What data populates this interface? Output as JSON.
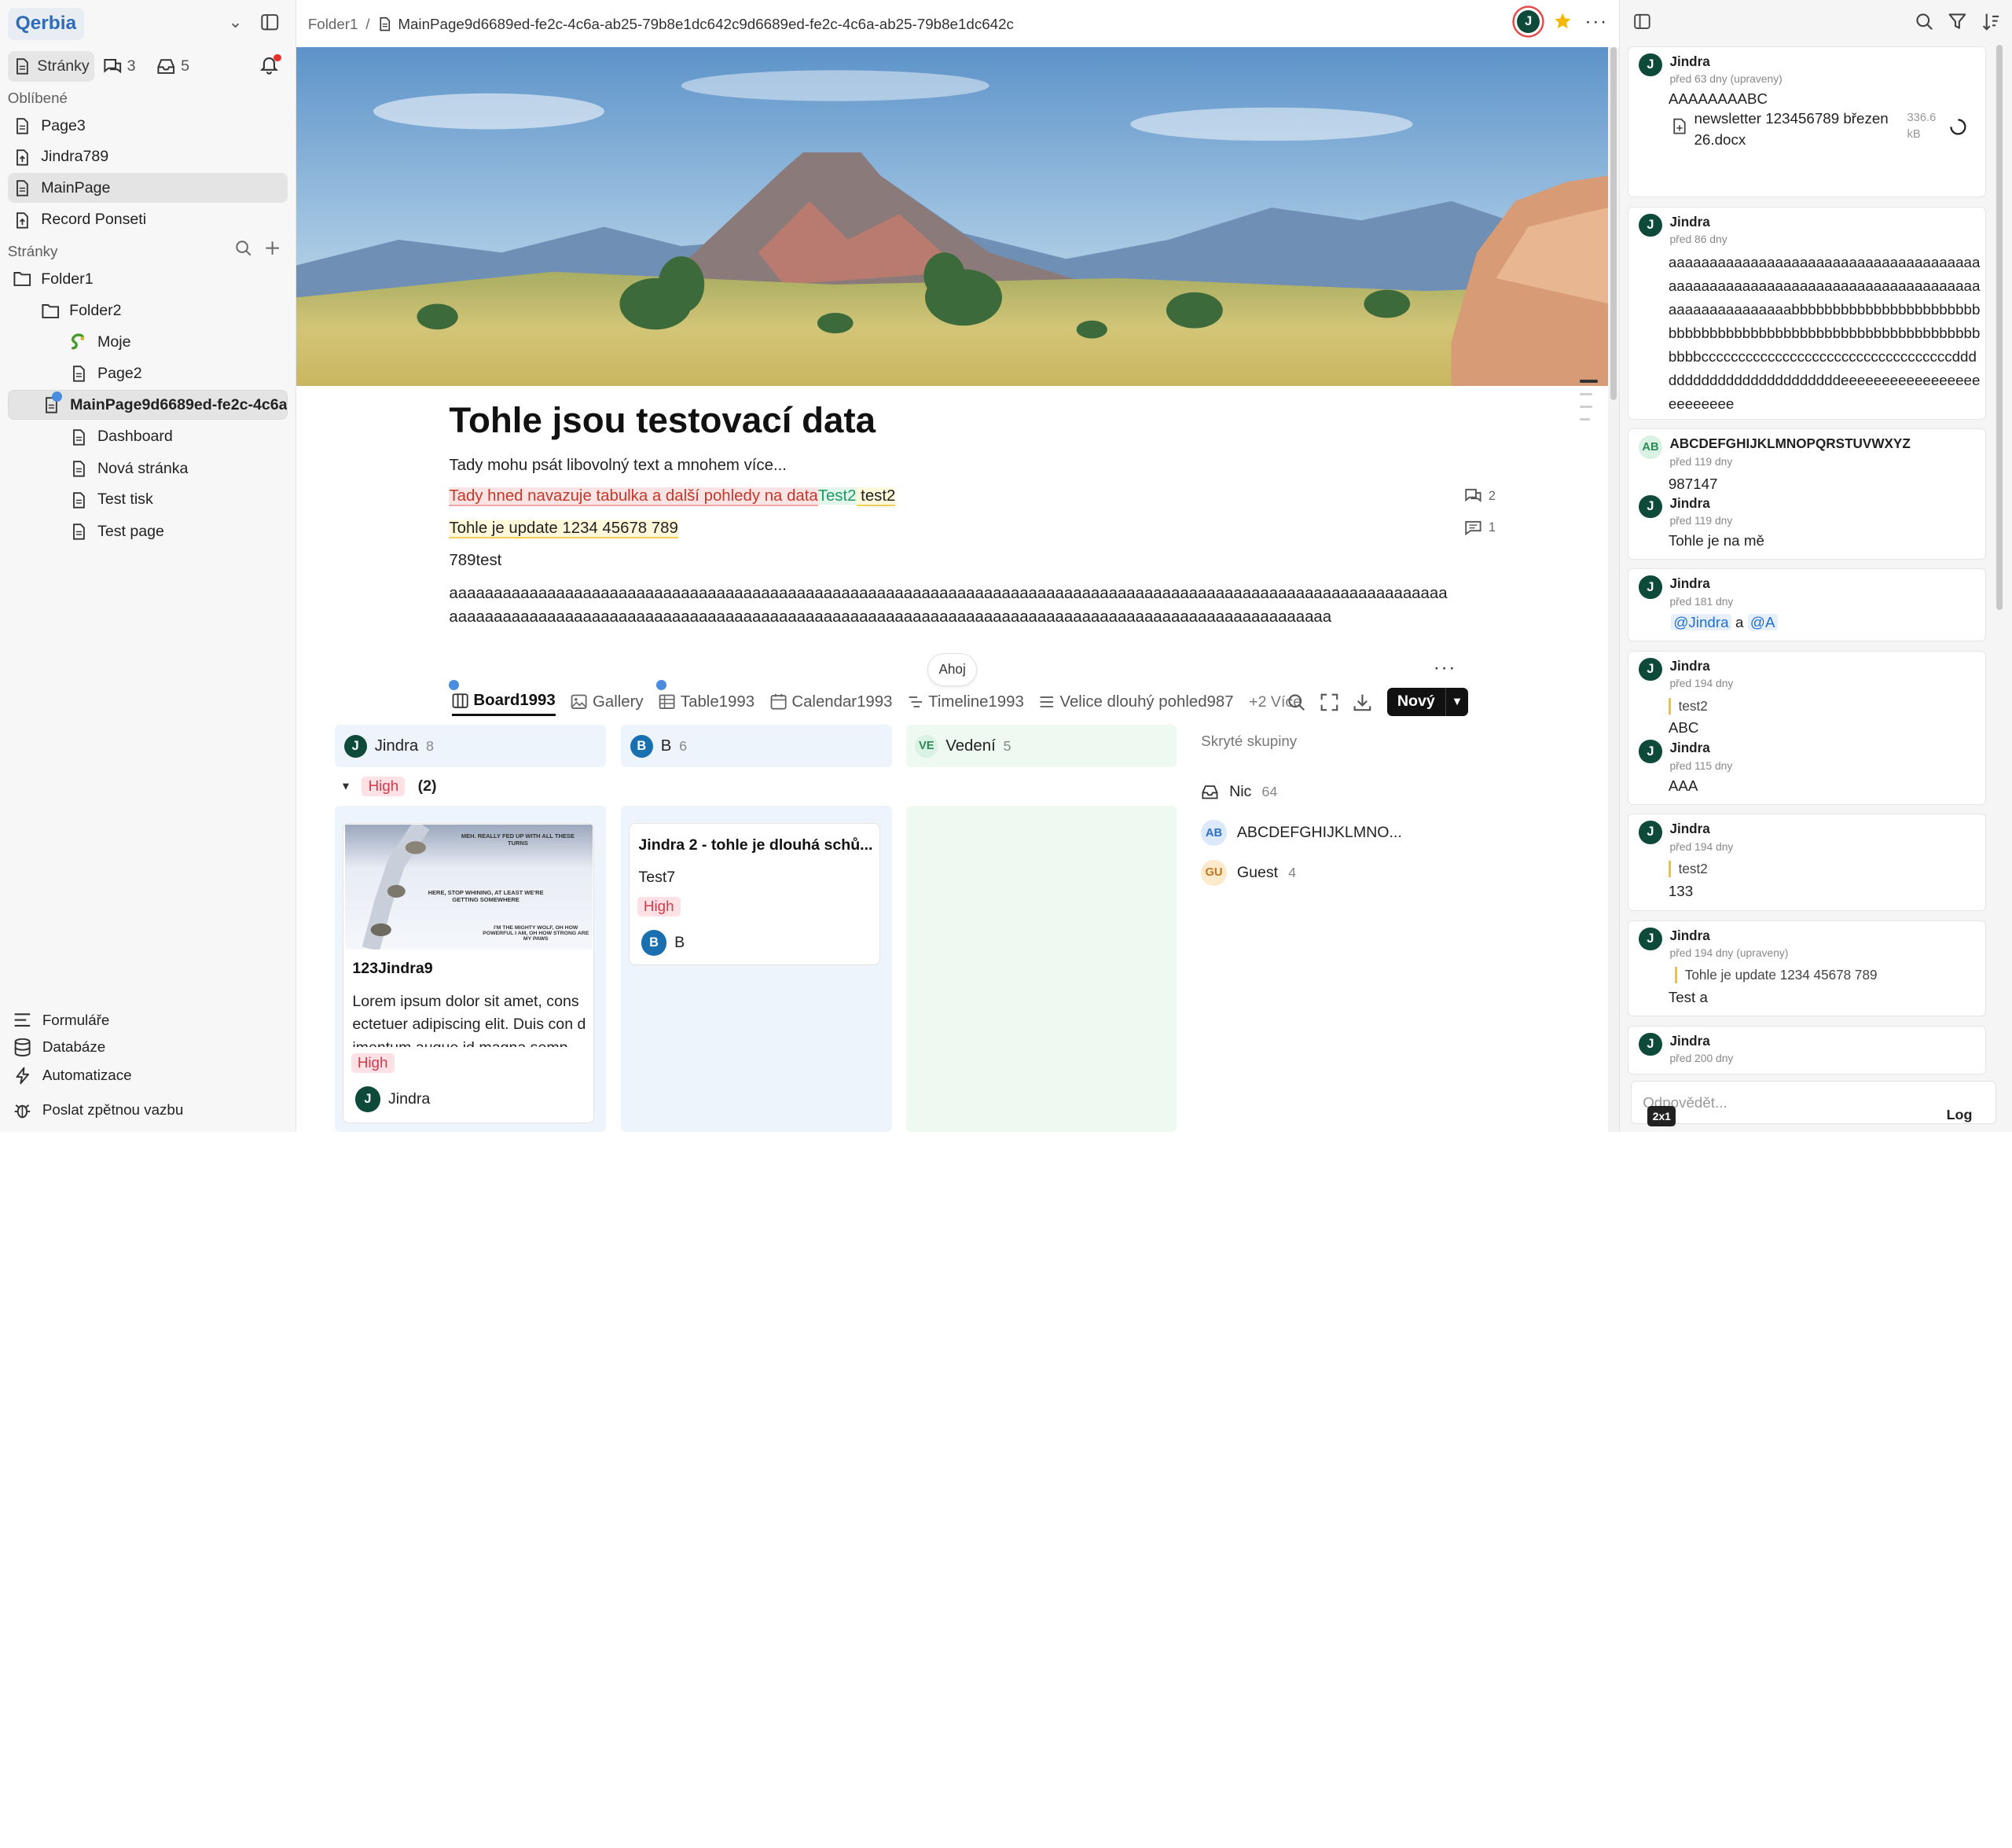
{
  "sidebar": {
    "logo": "Qerbia",
    "tabs": [
      {
        "label": "Stránky",
        "icon": "page-icon"
      },
      {
        "count": "3",
        "icon": "chat-icon"
      },
      {
        "count": "5",
        "icon": "inbox-icon"
      }
    ],
    "favorites_label": "Oblíbené",
    "favorites": [
      {
        "label": "Page3",
        "icon": "page-icon"
      },
      {
        "label": "Jindra789",
        "icon": "record-icon"
      },
      {
        "label": "MainPage",
        "icon": "page-icon",
        "active": true
      },
      {
        "label": "Record Ponseti",
        "icon": "record-icon"
      }
    ],
    "pages_label": "Stránky",
    "tree": [
      {
        "label": "Folder1",
        "icon": "folder-icon",
        "level": 0
      },
      {
        "label": "Folder2",
        "icon": "folder-icon",
        "level": 1
      },
      {
        "label": "Moje",
        "icon": "snake-icon",
        "level": 2
      },
      {
        "label": "Page2",
        "icon": "page-icon",
        "level": 2
      },
      {
        "label": "MainPage9d6689ed-fe2c-4c6a-a...",
        "icon": "page-icon",
        "level": 1,
        "selected": true
      },
      {
        "label": "Dashboard",
        "icon": "page-icon",
        "level": 2
      },
      {
        "label": "Nová stránka",
        "icon": "page-icon",
        "level": 2
      },
      {
        "label": "Test tisk",
        "icon": "page-icon",
        "level": 2
      },
      {
        "label": "Test page",
        "icon": "page-icon",
        "level": 2
      }
    ],
    "bottom": [
      {
        "label": "Formuláře",
        "icon": "form-icon"
      },
      {
        "label": "Databáze",
        "icon": "database-icon"
      },
      {
        "label": "Automatizace",
        "icon": "lightning-icon"
      },
      {
        "label": "Poslat zpětnou vazbu",
        "icon": "bug-icon"
      }
    ]
  },
  "topbar": {
    "breadcrumb_folder": "Folder1",
    "breadcrumb_sep": "/",
    "breadcrumb_page": "MainPage9d6689ed-fe2c-4c6a-ab25-79b8e1dc642c9d6689ed-fe2c-4c6a-ab25-79b8e1dc642c",
    "avatar": "J"
  },
  "doc": {
    "title": "Tohle jsou testovací data",
    "line1": "Tady mohu psát libovolný text a mnohem více...",
    "line2_red": "Tady hned navazuje tabulka a další pohledy na data",
    "line2_green": "Test2",
    "line2_yellow": " test2",
    "line3": "Tohle je update 1234 45678 789",
    "line4": "789test",
    "long_text": "aaaaaaaaaaaaaaaaaaaaaaaaaaaaaaaaaaaaaaaaaaaaaaaaaaaaaaaaaaaaaaaaaaaaaaaaaaaaaaaaaaaaaaaaaaaaaaaaaaaaaaaaaaaaaaaaaaaaaaaaaaaaaaaaaaaaaaaaaaaaaaaaaaaaaaaaaaaaaaaaaaaaaaaaaaaaaaaaaaaaaaaaaaaaaaaaaaaaaaaaaaaaaaaaaaa",
    "comments_count_1": "2",
    "comments_count_2": "1",
    "floating_label": "Ahoj"
  },
  "views": {
    "tabs": [
      {
        "label": "Board1993",
        "icon": "board-icon",
        "active": true,
        "globe": true
      },
      {
        "label": "Gallery",
        "icon": "gallery-icon"
      },
      {
        "label": "Table1993",
        "icon": "table-icon",
        "globe": true
      },
      {
        "label": "Calendar1993",
        "icon": "calendar-icon"
      },
      {
        "label": "Timeline1993",
        "icon": "timeline-icon"
      },
      {
        "label": "Velice dlouhý pohled987",
        "icon": "list-icon"
      }
    ],
    "more_label": "+2 Více",
    "new_button": "Nový"
  },
  "board": {
    "columns": [
      {
        "name": "Jindra",
        "count": "8",
        "avatar": "J",
        "avatar_color": "#0e4a3a",
        "bg": "#edf4fb"
      },
      {
        "name": "B",
        "count": "6",
        "avatar": "B",
        "avatar_color": "#1a6fb0",
        "bg": "#edf4fb"
      },
      {
        "name": "Vedení",
        "count": "5",
        "avatar": "VE",
        "avatar_color": "#d9f2e3",
        "bg": "#edf9f1"
      }
    ],
    "group_label": "High",
    "group_count": "(2)",
    "card1": {
      "title": "123Jindra9",
      "body": "Lorem ipsum dolor sit amet, consectetuer adipiscing elit. Duis con dimentum augue id magna semp",
      "badge": "High",
      "user": "Jindra"
    },
    "card1_image_text": [
      "MEH. REALLY FED UP WITH ALL THESE TURNS",
      "HERE, STOP WHINING, AT LEAST WE'RE GETTING SOMEWHERE",
      "I'M THE MIGHTY WOLF, OH HOW POWERFUL I AM, OH HOW STRONG ARE MY PAWS"
    ],
    "card2": {
      "title": "Jindra 2 - tohle je dlouhá schů...",
      "body": "Test7",
      "badge": "High",
      "user": "B"
    },
    "hidden_label": "Skryté skupiny",
    "hidden": [
      {
        "name": "Nic",
        "count": "64",
        "icon": "inbox-icon"
      },
      {
        "name": "ABCDEFGHIJKLMNO...",
        "avatar": "AB"
      },
      {
        "name": "Guest",
        "count": "4",
        "avatar": "GU"
      }
    ]
  },
  "comments": [
    {
      "name": "Jindra",
      "time": "před 63 dny (upraveny)",
      "text": "AAAAAAAABC",
      "file": "newsletter 123456789 březen 26.docx",
      "size": "336.6 kB"
    },
    {
      "name": "Jindra",
      "time": "před 86 dny",
      "text": "aaaaaaaaaaaaaaaaaaaaaaaaaaaaaaaaaaaaaaaaaaaaaaaaaaaaaaaaaaaaaaaaaaaaaaaaaaaaaaaaaaaaaaaaaaabbbbbbbbbbbbbbbbbbbbbbbbbbbbbbbbbbbbbbbbbbbbbbbbbbbbbbbbbbbbbbbbbccccccccccccccccccccccccccccccccccddddddddddddddddddddddddeeeeeeeeeeeeeeeeeeeeeeeee"
    },
    {
      "name": "ABCDEFGHIJKLMNOPQRSTUVWXYZ",
      "time": "před 119 dny",
      "text": "987147",
      "reply_name": "Jindra",
      "reply_time": "před 119 dny",
      "reply_text": "Tohle je na mě"
    },
    {
      "name": "Jindra",
      "time": "před 181 dny",
      "mention1": "@Jindra",
      "mid": "a",
      "mention2": "@A"
    },
    {
      "name": "Jindra",
      "time": "před 194 dny",
      "quote": "test2",
      "text": "ABC",
      "reply_name": "Jindra",
      "reply_time": "před 115 dny",
      "reply_text": "AAA"
    },
    {
      "name": "Jindra",
      "time": "před 194 dny",
      "quote": "test2",
      "text": "133"
    },
    {
      "name": "Jindra",
      "time": "před 194 dny (upraveny)",
      "quote": "Tohle je update 1234 45678 789",
      "text": "Test a"
    },
    {
      "name": "Jindra",
      "time": "před 200 dny"
    }
  ],
  "reply": {
    "placeholder": "Odpovědět...",
    "log": "Log",
    "badge": "2x1"
  }
}
